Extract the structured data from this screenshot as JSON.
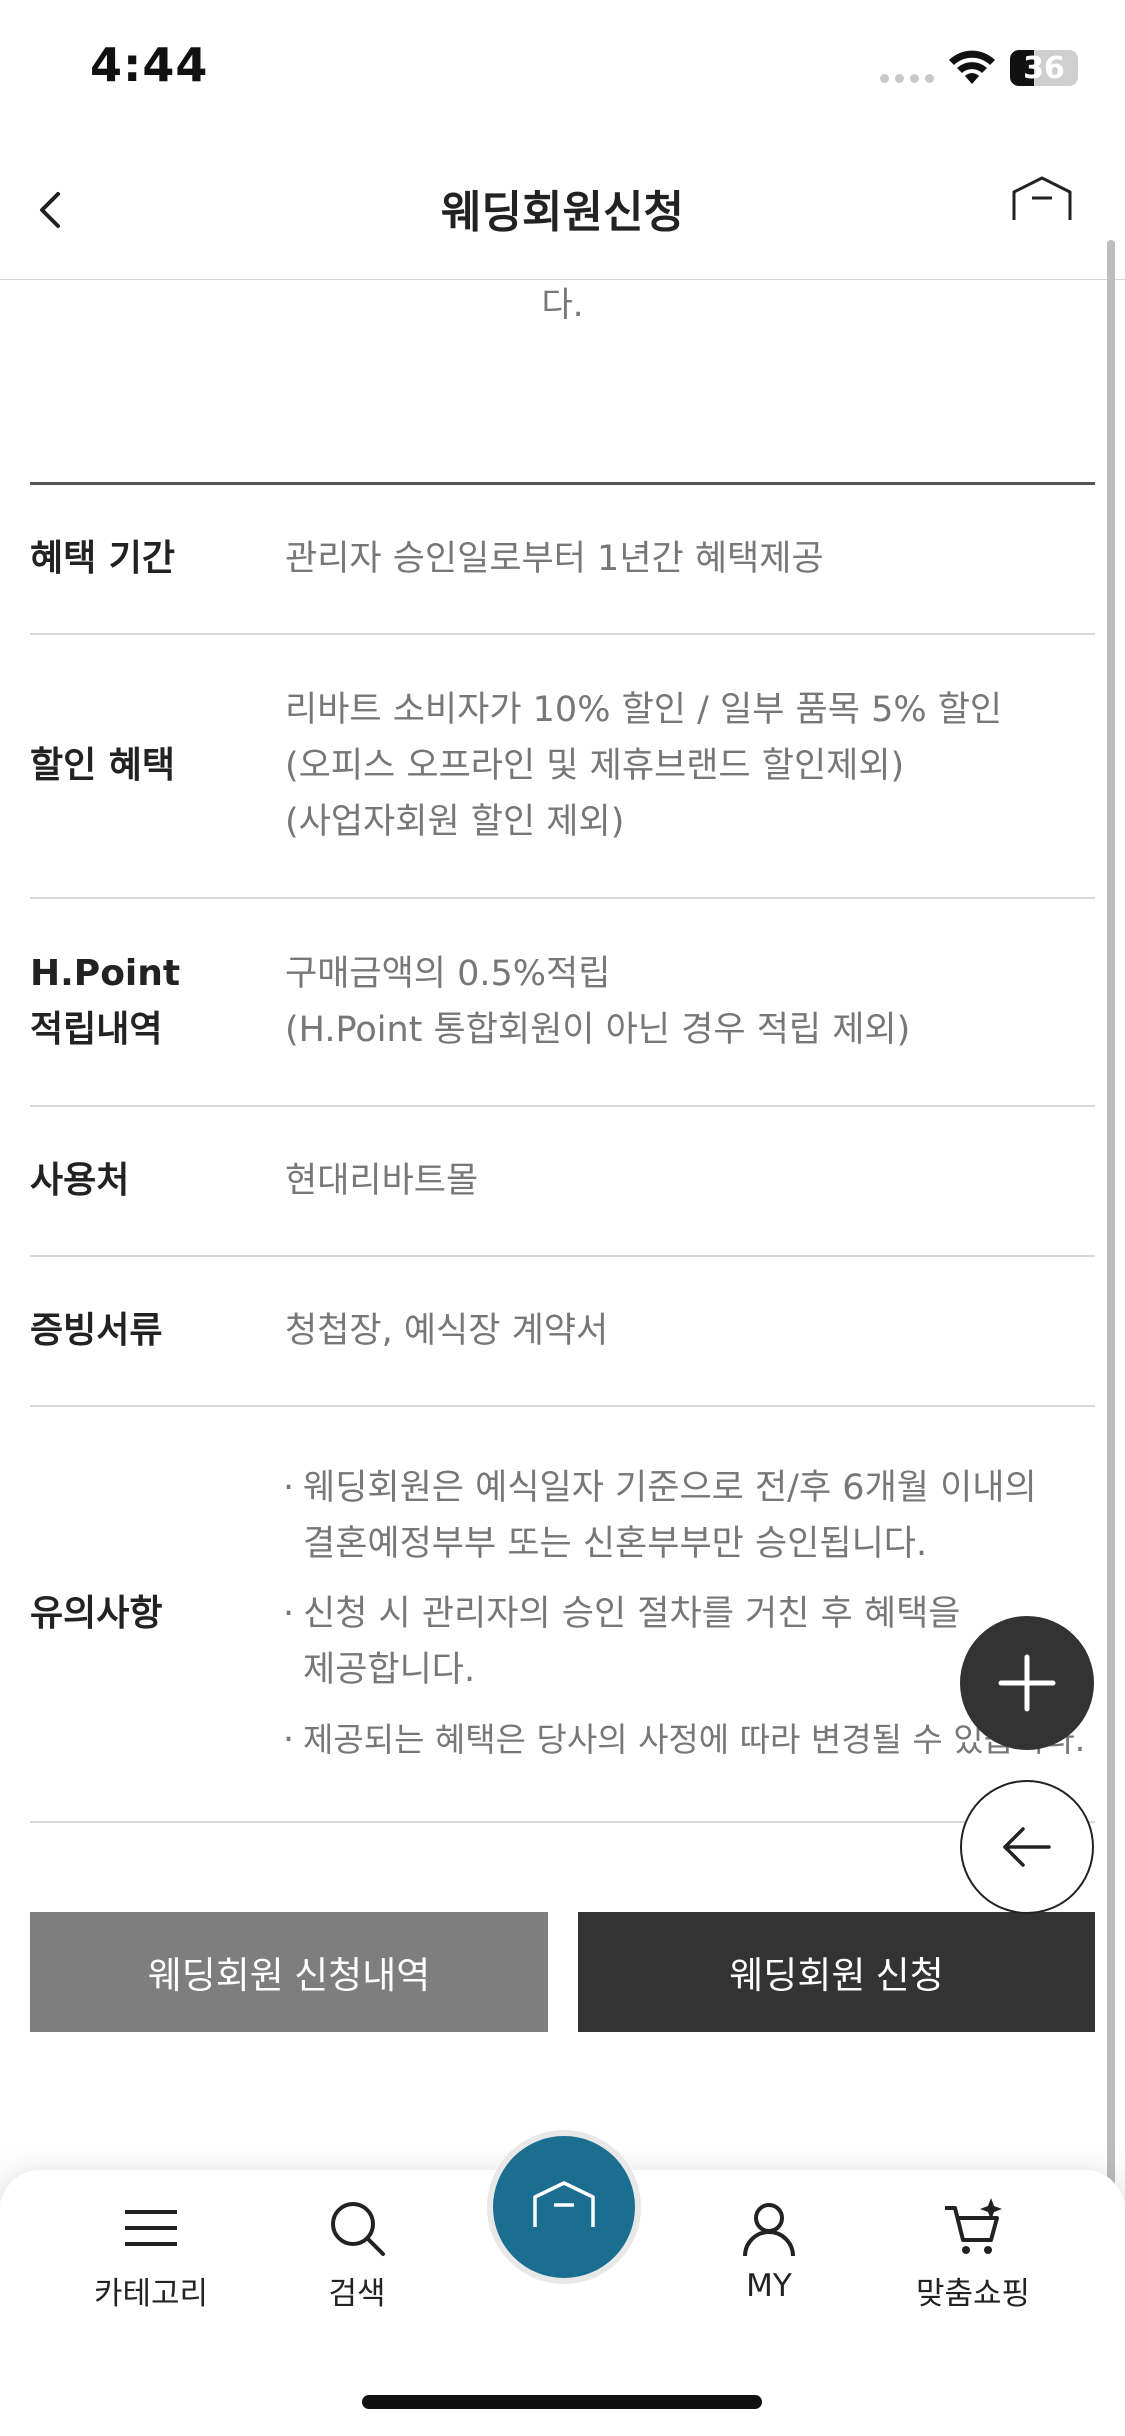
{
  "status_bar": {
    "time": "4:44",
    "battery_level": "36",
    "battery_percent": 36
  },
  "header": {
    "title": "웨딩회원신청",
    "back_icon": "chevron-left-icon",
    "home_icon": "home-icon"
  },
  "clipped_text": "다.",
  "benefits": [
    {
      "label": "혜택 기간",
      "lines": [
        "관리자 승인일로부터 1년간 혜택제공"
      ]
    },
    {
      "label": "할인 혜택",
      "lines": [
        "리바트 소비자가 10% 할인 / 일부 품목 5% 할인",
        "(오피스 오프라인 및 제휴브랜드 할인제외)",
        "(사업자회원 할인 제외)"
      ]
    },
    {
      "label_lines": [
        "H.Point",
        "적립내역"
      ],
      "lines": [
        "구매금액의 0.5%적립",
        "(H.Point 통합회원이 아닌 경우 적립 제외)"
      ]
    },
    {
      "label": "사용처",
      "lines": [
        "현대리바트몰"
      ]
    },
    {
      "label": "증빙서류",
      "lines": [
        "청첩장, 예식장 계약서"
      ]
    },
    {
      "label": "유의사항",
      "bullets": [
        [
          "웨딩회원은 예식일자 기준으로 전/후 6개월 이내의",
          "결혼예정부부 또는 신혼부부만 승인됩니다."
        ],
        [
          "신청 시 관리자의 승인 절차를 거친 후 혜택을",
          "제공합니다."
        ],
        [
          "제공되는 혜택은 당사의 사정에 따라 변경될 수 있습니다."
        ]
      ]
    }
  ],
  "buttons": {
    "history": "웨딩회원 신청내역",
    "apply": "웨딩회원 신청"
  },
  "floating": {
    "plus_icon": "plus-icon",
    "back_icon": "arrow-left-icon"
  },
  "bottom_nav": {
    "category": "카테고리",
    "search": "검색",
    "home_icon": "home-icon",
    "my": "MY",
    "custom_shopping": "맞춤쇼핑"
  },
  "colors": {
    "nav_home_bg": "#1b6e90",
    "history_button": "#7e7e7e",
    "apply_button": "#333333"
  }
}
